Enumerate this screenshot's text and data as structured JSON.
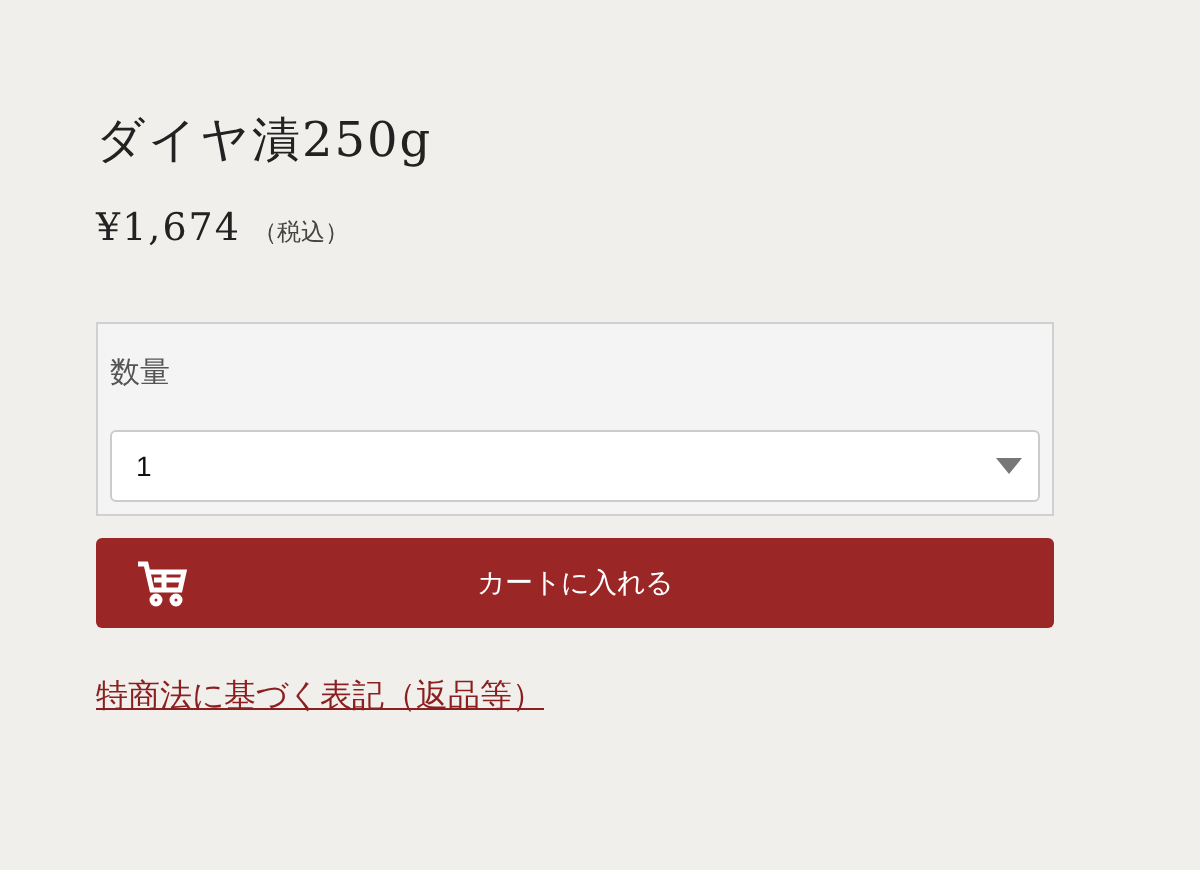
{
  "product": {
    "title": "ダイヤ漬250g",
    "price": "¥1,674",
    "tax_note": "（税込）"
  },
  "quantity": {
    "label": "数量",
    "value": "1"
  },
  "cart_button": {
    "label": "カートに入れる"
  },
  "legal_link": {
    "label": "特商法に基づく表記（返品等）"
  }
}
